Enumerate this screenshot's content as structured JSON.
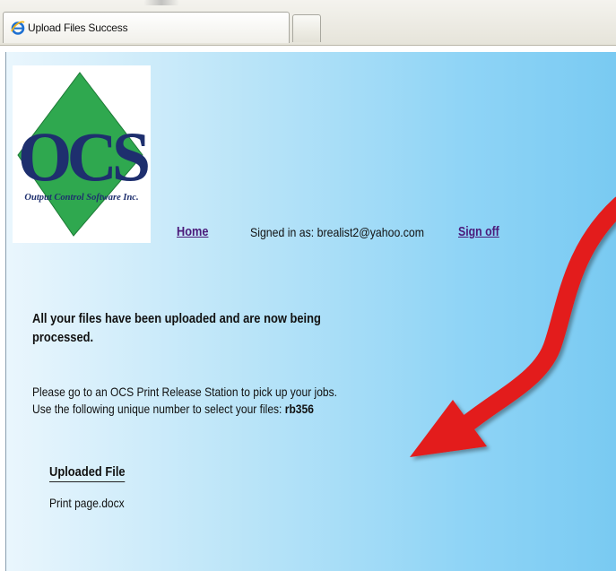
{
  "browser": {
    "tab_title": "Upload Files Success"
  },
  "logo": {
    "letters": "OCS",
    "company": "Output Control Software Inc."
  },
  "nav": {
    "home": "Home",
    "signed_in_label": "Signed in as:",
    "user_email": "brealist2@yahoo.com",
    "sign_off": "Sign off"
  },
  "message": {
    "line1": "All your files have been uploaded and are now being",
    "line2": "processed.",
    "instruction": "Please go to an OCS Print Release Station to pick up your jobs.",
    "code_prefix": "Use the following unique number to select your files:",
    "code": "rb356"
  },
  "uploaded": {
    "header": "Uploaded File",
    "files": [
      "Print page.docx"
    ]
  },
  "colors": {
    "link": "#4b1a7a",
    "background_start": "#eaf6fd",
    "background_end": "#79caf2",
    "annotation_arrow": "#e31b1b",
    "logo_green": "#2fa84f",
    "logo_navy": "#1e2f6e"
  },
  "icons": {
    "tab_icon": "ie-icon",
    "annotation": "red-curved-arrow"
  }
}
